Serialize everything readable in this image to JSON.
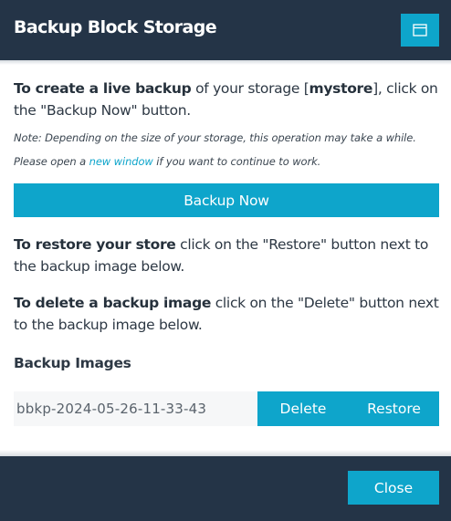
{
  "dialog": {
    "title": "Backup Block Storage",
    "window_icon": "window-icon"
  },
  "intro": {
    "bold": "To create a live backup",
    "text_before_store": " of your storage [",
    "store_name": "mystore",
    "text_after_store": "], click on the \"Backup Now\" button."
  },
  "note": {
    "text_before_link": "Note: Depending on the size of your storage, this operation may take a while. Please open a ",
    "link": "new window",
    "text_after_link": " if you want to continue to work."
  },
  "backup_button": "Backup Now",
  "restore_help": {
    "bold": "To restore your store",
    "text": " click on the \"Restore\" button next to the backup image below."
  },
  "delete_help": {
    "bold": "To delete a backup image",
    "text": " click on the \"Delete\" button next to the backup image below."
  },
  "images_heading": "Backup Images",
  "backup_images": [
    {
      "name": "bbkp-2024-05-26-11-33-43",
      "delete_label": "Delete",
      "restore_label": "Restore"
    }
  ],
  "footer": {
    "close_label": "Close"
  },
  "colors": {
    "header_bg": "#243447",
    "accent": "#0ea5cb",
    "text": "#2d3844"
  }
}
